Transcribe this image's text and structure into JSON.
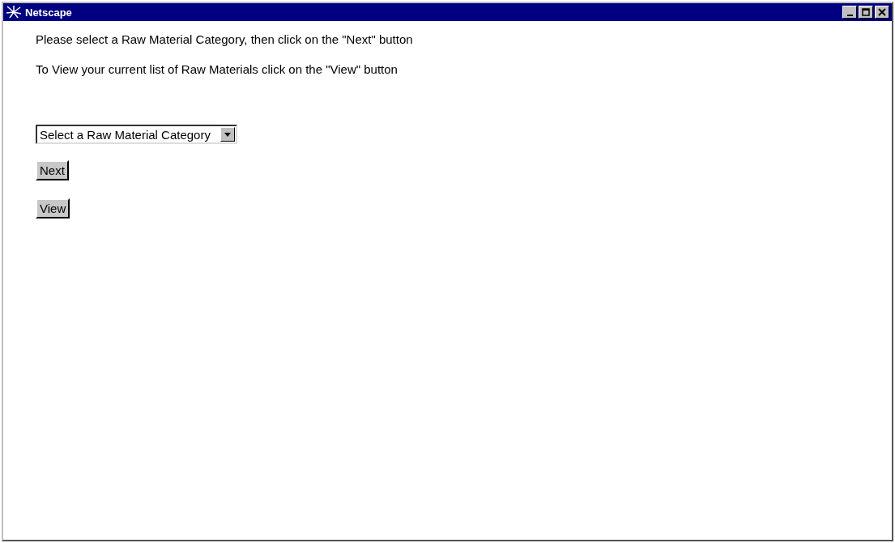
{
  "window": {
    "title": "Netscape"
  },
  "instructions": [
    "Please select a Raw Material Category, then click on the \"Next\" button",
    "To View your current list of Raw Materials click on the \"View\" button"
  ],
  "category_select": {
    "value": "Select a Raw Material Category"
  },
  "buttons": [
    "Next",
    "View"
  ]
}
